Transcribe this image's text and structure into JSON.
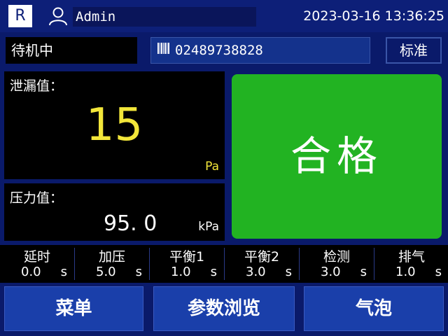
{
  "header": {
    "logo": "R",
    "user": "Admin",
    "datetime": "2023-03-16 13:36:25"
  },
  "status": "待机中",
  "barcode": "02489738828",
  "mode": "标准",
  "leak": {
    "label": "泄漏值：",
    "value": "15",
    "unit": "Pa"
  },
  "pressure": {
    "label": "压力值：",
    "value": "95. 0",
    "unit": "kPa"
  },
  "result": "合格",
  "params": [
    {
      "label": "延时",
      "value": "0.0",
      "unit": "s"
    },
    {
      "label": "加压",
      "value": "5.0",
      "unit": "s"
    },
    {
      "label": "平衡1",
      "value": "1.0",
      "unit": "s"
    },
    {
      "label": "平衡2",
      "value": "3.0",
      "unit": "s"
    },
    {
      "label": "检测",
      "value": "3.0",
      "unit": "s"
    },
    {
      "label": "排气",
      "value": "1.0",
      "unit": "s"
    }
  ],
  "buttons": {
    "menu": "菜单",
    "browse": "参数浏览",
    "bubble": "气泡"
  },
  "colors": {
    "background": "#0a1a6a",
    "pass_green": "#22b322",
    "value_yellow": "#f2e63a",
    "button_blue": "#1a3faa"
  },
  "icons": {
    "user": "user-icon",
    "barcode": "barcode-icon"
  }
}
